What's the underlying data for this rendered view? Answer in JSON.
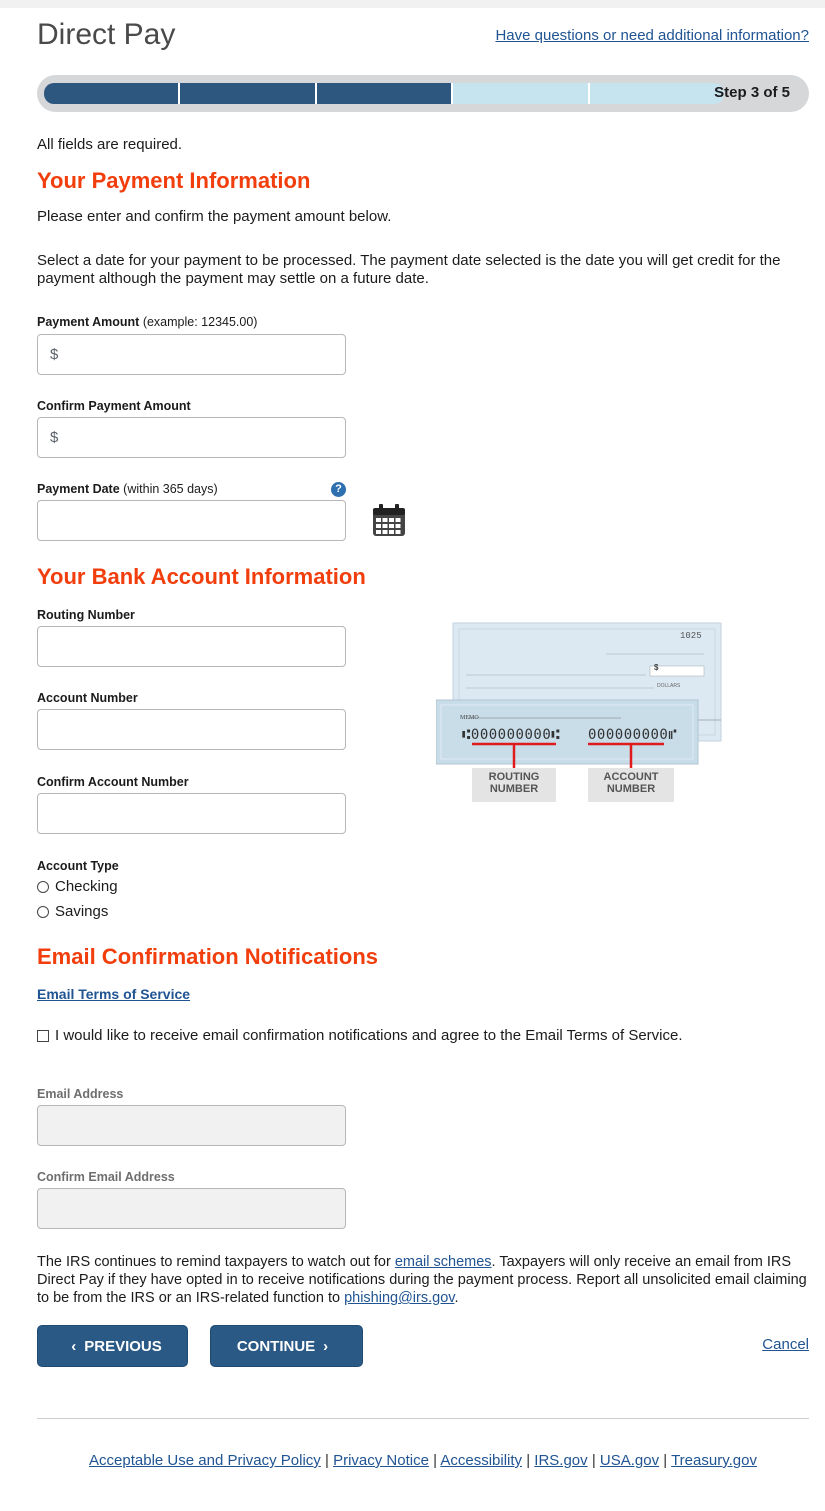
{
  "header": {
    "title": "Direct Pay",
    "help_link": "Have questions or need additional information?"
  },
  "progress": {
    "step_label": "Step 3 of 5",
    "current_step": 3,
    "total_steps": 5
  },
  "intro": {
    "required_note": "All fields are required."
  },
  "payment_section": {
    "heading": "Your Payment Information",
    "instruction": "Please enter and confirm the payment amount below.",
    "date_instruction": "Select a date for your payment to be processed. The payment date selected is the date you will get credit for the payment although the payment may settle on a future date.",
    "amount_label": "Payment Amount",
    "amount_hint": "(example: 12345.00)",
    "amount_prefix": "$",
    "confirm_amount_label": "Confirm Payment Amount",
    "confirm_amount_prefix": "$",
    "date_label": "Payment Date",
    "date_hint": "(within 365 days)",
    "help_icon_text": "?"
  },
  "bank_section": {
    "heading": "Your Bank Account Information",
    "routing_label": "Routing Number",
    "account_label": "Account Number",
    "confirm_account_label": "Confirm Account Number",
    "account_type_label": "Account Type",
    "options": [
      "Checking",
      "Savings"
    ],
    "check_image": {
      "check_number": "1025",
      "dollars_text": "DOLLARS",
      "dollar_sign": "$",
      "memo_text": "MEMO",
      "micr_routing": "⑆000000000⑆",
      "micr_account": "000000000⑈",
      "routing_caption_1": "ROUTING",
      "routing_caption_2": "NUMBER",
      "account_caption_1": "ACCOUNT",
      "account_caption_2": "NUMBER"
    }
  },
  "email_section": {
    "heading": "Email Confirmation Notifications",
    "terms_link": "Email Terms of Service",
    "consent_text": "I would like to receive email confirmation notifications and agree to the Email Terms of Service.",
    "email_label": "Email Address",
    "confirm_email_label": "Confirm Email Address"
  },
  "notice": {
    "part1": "The IRS continues to remind taxpayers to watch out for ",
    "link1": "email schemes",
    "part2": ". Taxpayers will only receive an email from IRS Direct Pay if they have opted in to receive notifications during the payment process. Report all unsolicited email claiming to be from the IRS or an IRS-related function to ",
    "link2": "phishing@irs.gov",
    "part3": "."
  },
  "actions": {
    "previous_label": "PREVIOUS",
    "continue_label": "CONTINUE",
    "cancel_label": "Cancel"
  },
  "footer": {
    "links": [
      "Acceptable Use and Privacy Policy",
      "Privacy Notice",
      "Accessibility",
      "IRS.gov",
      "USA.gov",
      "Treasury.gov"
    ],
    "separator": "|"
  },
  "colors": {
    "accent_heading": "#f13e0c",
    "button_bg": "#2a5985",
    "progress_done": "#2e5780",
    "progress_todo": "#c6e3f0",
    "link": "#205493"
  }
}
